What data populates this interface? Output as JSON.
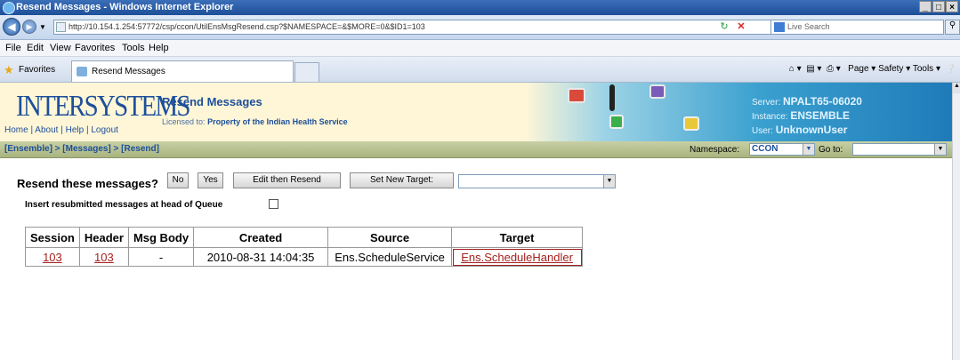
{
  "window": {
    "title": "Resend Messages - Windows Internet Explorer",
    "controls": [
      "_",
      "□",
      "×"
    ]
  },
  "address": {
    "url": "http://10.154.1.254:57772/csp/ccon/UtilEnsMsgResend.csp?$NAMESPACE=&$MORE=0&$ID1=103"
  },
  "search": {
    "placeholder": "Live Search"
  },
  "menu": [
    "File",
    "Edit",
    "View",
    "Favorites",
    "Tools",
    "Help"
  ],
  "favorites": {
    "label": "Favorites",
    "tab_title": "Resend Messages",
    "commands": "Page ▾   Safety ▾   Tools ▾"
  },
  "header": {
    "logo": "INTERSYSTEMS",
    "links": {
      "home": "Home",
      "about": "About",
      "help": "Help",
      "logout": "Logout"
    },
    "title": "Resend Messages",
    "licensed_label": "Licensed to:",
    "licensed_to": "Property of the Indian Health Service",
    "server_label": "Server:",
    "server": "NPALT65-06020",
    "instance_label": "Instance:",
    "instance": "ENSEMBLE",
    "user_label": "User:",
    "user": "UnknownUser"
  },
  "breadcrumb": "[Ensemble] > [Messages] > [Resend]",
  "namespace": {
    "label": "Namespace:",
    "value": "CCON",
    "goto_label": "Go to:"
  },
  "resend": {
    "question": "Resend these messages?",
    "no": "No",
    "yes": "Yes",
    "edit": "Edit then Resend",
    "set_target": "Set New Target:",
    "insert_label": "Insert resubmitted messages at head of Queue"
  },
  "table": {
    "headers": [
      "Session",
      "Header",
      "Msg Body",
      "Created",
      "Source",
      "Target"
    ],
    "rows": [
      {
        "session": "103",
        "header": "103",
        "body": "-",
        "created": "2010-08-31 14:04:35",
        "source": "Ens.ScheduleService",
        "target": "Ens.ScheduleHandler"
      }
    ]
  }
}
